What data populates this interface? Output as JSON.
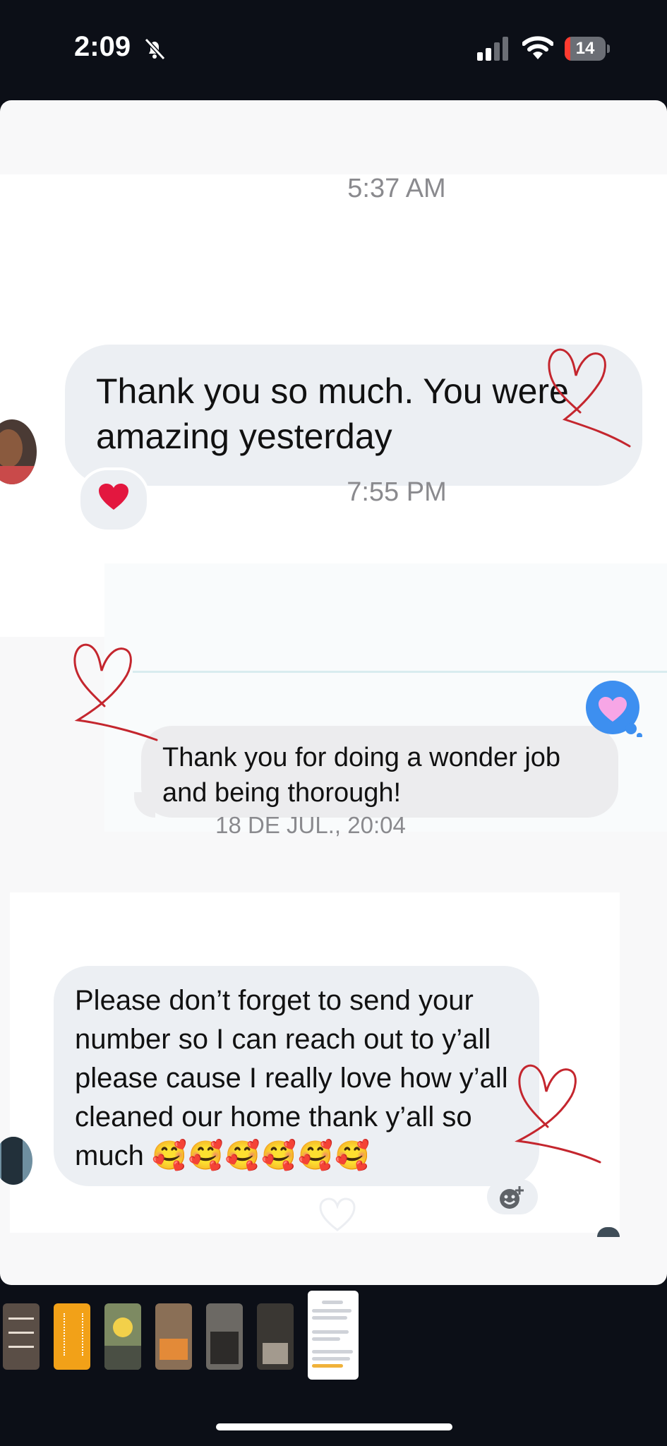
{
  "status_bar": {
    "time": "2:09",
    "battery_level": "14",
    "silent_mode": true,
    "battery_color": "#ff3b30"
  },
  "conversation": [
    {
      "timestamp": "5:37 AM",
      "message": "Thank you so much. You were amazing yesterday",
      "reaction_icon": "red-heart-icon"
    },
    {
      "timestamp": "7:55 PM"
    },
    {
      "message": "Thank you for doing a wonder job and being thorough!",
      "reaction_icon": "pink-heart-icon"
    },
    {
      "timestamp": "18 DE JUL., 20:04",
      "message_text": "Please don’t forget to send your number so I can reach out to y’all please cause I really love how y’all cleaned our home thank y’all so much",
      "message_emojis": "🥰🥰🥰🥰🥰🥰",
      "action_icon": "add-reaction-icon"
    }
  ],
  "story_thumbnails": {
    "count": 7,
    "active_index": 6,
    "icons": [
      "thumb-1",
      "thumb-2",
      "thumb-3",
      "thumb-4",
      "thumb-5",
      "thumb-6",
      "thumb-7"
    ]
  },
  "colors": {
    "background": "#0c0f17",
    "bubble": "#eceff3",
    "timestamp_text": "#8a8a8e",
    "doodle_heart": "#c4262e",
    "reaction_badge": "#3d8ff0"
  }
}
